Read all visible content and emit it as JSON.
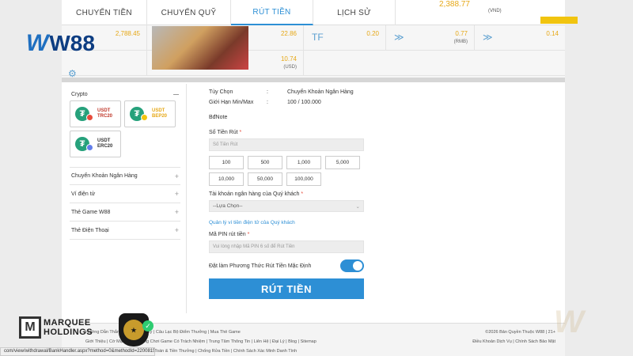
{
  "tabs": [
    {
      "label": "CHUYỂN TIỀN",
      "active": false
    },
    {
      "label": "CHUYỂN QUỸ",
      "active": false
    },
    {
      "label": "RÚT TIỀN",
      "active": true
    },
    {
      "label": "LỊCH SỬ",
      "active": false
    }
  ],
  "top_balance": {
    "value": "2,388.77",
    "currency": "(VND)"
  },
  "balances": {
    "b1": {
      "value": "2,788.45"
    },
    "b2": {
      "value": "22.86"
    },
    "b3": {
      "value": "0.20"
    },
    "b4": {
      "value": "0.77",
      "currency": "(RMB)"
    },
    "b5": {
      "value": "0.14"
    },
    "b6": {
      "value": "10.74",
      "currency": "(USD)"
    }
  },
  "sidebar": {
    "crypto_title": "Crypto",
    "crypto_toggle": "—",
    "crypto_options": [
      {
        "line1": "USDT",
        "line2": "TRC20",
        "net_color": "#e74c3c"
      },
      {
        "line1": "USDT",
        "line2": "BEP20",
        "net_color": "#f1c40f"
      },
      {
        "line1": "USDT",
        "line2": "ERC20",
        "net_color": "#627eea"
      }
    ],
    "items": [
      {
        "label": "Chuyển Khoản Ngân Hàng"
      },
      {
        "label": "Ví điện tử"
      },
      {
        "label": "Thẻ Game W88"
      },
      {
        "label": "Thẻ Điện Thoại"
      }
    ]
  },
  "form": {
    "option_key": "Tùy Chọn",
    "option_value": "Chuyển Khoản Ngân Hàng",
    "limit_key": "Giới Hạn Min/Max",
    "limit_value": "100 / 100.000",
    "note": "BđNote",
    "amount_label": "Số Tiền Rút",
    "amount_placeholder": "Số Tiền Rút",
    "amounts": [
      "100",
      "500",
      "1,000",
      "5,000",
      "10,000",
      "50,000",
      "100,000"
    ],
    "bank_label": "Tài khoản ngân hàng của Quý khách",
    "bank_select": "--Lựa Chọn--",
    "wallet_link": "Quản lý ví tiền điện tử của Quý khách",
    "pin_label": "Mã PIN rút tiền",
    "pin_placeholder": "Vui lòng nhập Mã PIN 6 số để Rút Tiền",
    "default_label": "Đặt làm Phương Thức Rút Tiền Mặc Định",
    "default_on": true,
    "submit_label": "RÚT TIỀN"
  },
  "footer": {
    "row1": "Hướng Dẫn Thắng Lớn | Sổ Lucky | Câu Lạc Bộ Điểm Thưởng | Mua Thẻ Game",
    "row2": "Giới Thiệu | Cờ Mặc Quan Trọng Chơi Game Có Trách Nhiệm | Trung Tâm Thông Tin | Liên Hệ | Đại Lý | Blog | Sitemap",
    "row3": "Hỗ trợ Gửi Nạp | Tài Khoản, Thanh Toán & Tiền Thưởng | Chống Rửa Tiền | Chính Sách Xác Minh Danh Tính",
    "copyright": "©2026 Bản Quyền Thuộc W88 | 21+",
    "terms": "Điều Khoản Dịch Vụ | Chính Sách Bảo Mật"
  },
  "overlays": {
    "w88_text": "W88",
    "marquee_line1": "MARQUEE",
    "marquee_line2": "HOLDINGS",
    "status_url": "com/view/withdrawal/BankHandler.aspx?method=0&methodId=220081545"
  },
  "colors": {
    "accent": "#2d8fd5",
    "balance": "#e6a817",
    "tether": "#26a17b"
  }
}
